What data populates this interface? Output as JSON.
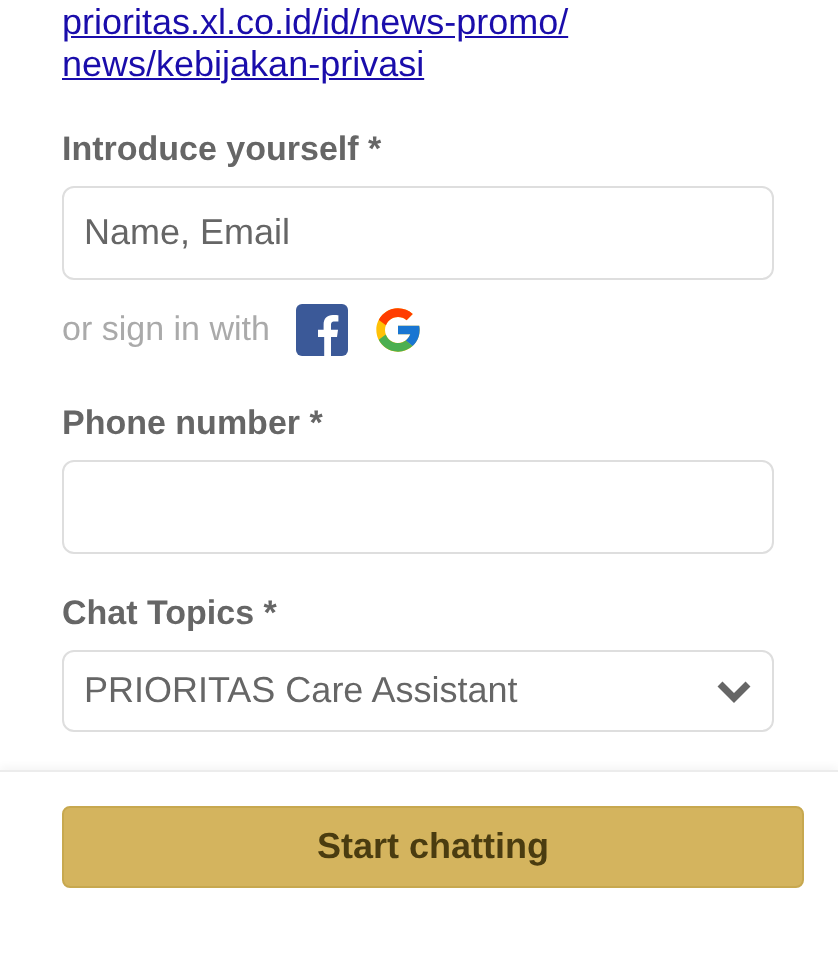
{
  "privacy_link": "prioritas.xl.co.id/id/news-promo/news/kebijakan-privasi",
  "fields": [
    {
      "kind": "text",
      "label": "Introduce yourself *",
      "placeholder": "Name, Email"
    },
    {
      "kind": "social",
      "label": "or sign in with"
    },
    {
      "kind": "text",
      "label": "Phone number *"
    },
    {
      "kind": "select",
      "label": "Chat Topics *",
      "value": "PRIORITAS Care Assistant"
    }
  ],
  "submit_button": "Start chatting"
}
